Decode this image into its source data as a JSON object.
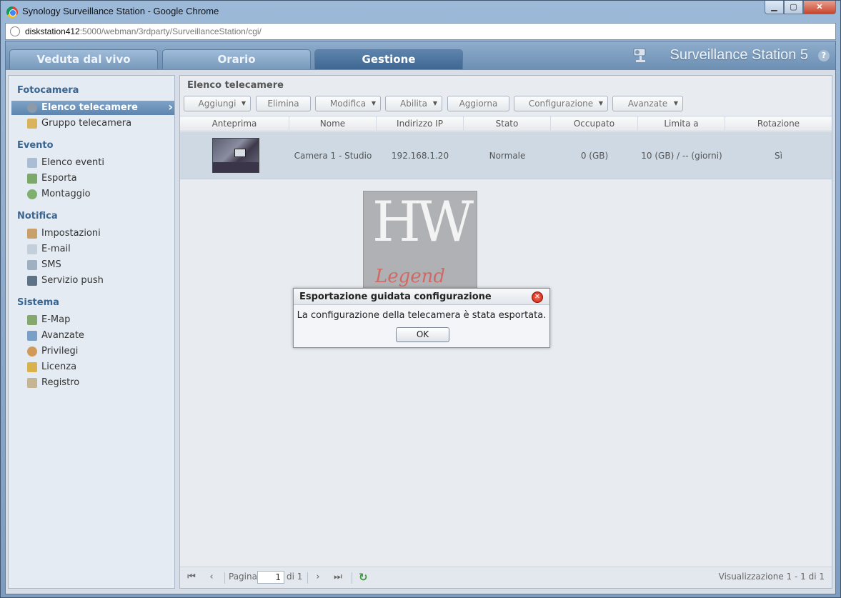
{
  "window": {
    "title": "Synology Surveillance Station - Google Chrome",
    "buttons": {
      "minimize": "▁",
      "maximize": "▢",
      "close": "✕"
    }
  },
  "address_bar": {
    "host": "diskstation412",
    "rest": ":5000/webman/3rdparty/SurveillanceStation/cgi/"
  },
  "header": {
    "tabs": [
      {
        "label": "Veduta dal vivo",
        "active": false
      },
      {
        "label": "Orario",
        "active": false
      },
      {
        "label": "Gestione",
        "active": true
      }
    ],
    "brand": "Surveillance Station 5",
    "help": "?"
  },
  "sidebar": {
    "sections": [
      {
        "title": "Fotocamera",
        "items": [
          {
            "label": "Elenco telecamere",
            "icon": "camera-icon",
            "selected": true
          },
          {
            "label": "Gruppo telecamera",
            "icon": "folder-camera-icon"
          }
        ]
      },
      {
        "title": "Evento",
        "items": [
          {
            "label": "Elenco eventi",
            "icon": "event-list-icon"
          },
          {
            "label": "Esporta",
            "icon": "export-icon"
          },
          {
            "label": "Montaggio",
            "icon": "montage-icon"
          }
        ]
      },
      {
        "title": "Notifica",
        "items": [
          {
            "label": "Impostazioni",
            "icon": "wrench-icon"
          },
          {
            "label": "E-mail",
            "icon": "envelope-icon"
          },
          {
            "label": "SMS",
            "icon": "phone-icon"
          },
          {
            "label": "Servizio push",
            "icon": "mobile-device-icon"
          }
        ]
      },
      {
        "title": "Sistema",
        "items": [
          {
            "label": "E-Map",
            "icon": "map-icon"
          },
          {
            "label": "Avanzate",
            "icon": "advanced-settings-icon"
          },
          {
            "label": "Privilegi",
            "icon": "users-icon"
          },
          {
            "label": "Licenza",
            "icon": "key-icon"
          },
          {
            "label": "Registro",
            "icon": "book-icon"
          }
        ]
      }
    ]
  },
  "main": {
    "title": "Elenco telecamere",
    "toolbar": [
      {
        "label": "Aggiungi",
        "dropdown": true
      },
      {
        "label": "Elimina",
        "dropdown": false
      },
      {
        "label": "Modifica",
        "dropdown": true
      },
      {
        "label": "Abilita",
        "dropdown": true
      },
      {
        "label": "Aggiorna",
        "dropdown": false
      },
      {
        "label": "Configurazione",
        "dropdown": true
      },
      {
        "label": "Avanzate",
        "dropdown": true
      }
    ],
    "columns": [
      "Anteprima",
      "Nome",
      "Indirizzo IP",
      "Stato",
      "Occupato",
      "Limita a",
      "Rotazione"
    ],
    "rows": [
      {
        "name": "Camera 1 - Studio",
        "ip": "192.168.1.20",
        "status": "Normale",
        "used": "0 (GB)",
        "limit": "10 (GB) / -- (giorni)",
        "rotation": "Sì"
      }
    ],
    "pager": {
      "page_label": "Pagina",
      "page_value": "1",
      "of_label": "di 1",
      "summary": "Visualizzazione 1 - 1 di 1"
    }
  },
  "watermark": {
    "top": "HW",
    "bottom": "Legend"
  },
  "dialog": {
    "title": "Esportazione guidata configurazione",
    "message": "La configurazione della telecamera è stata esportata.",
    "ok": "OK"
  }
}
